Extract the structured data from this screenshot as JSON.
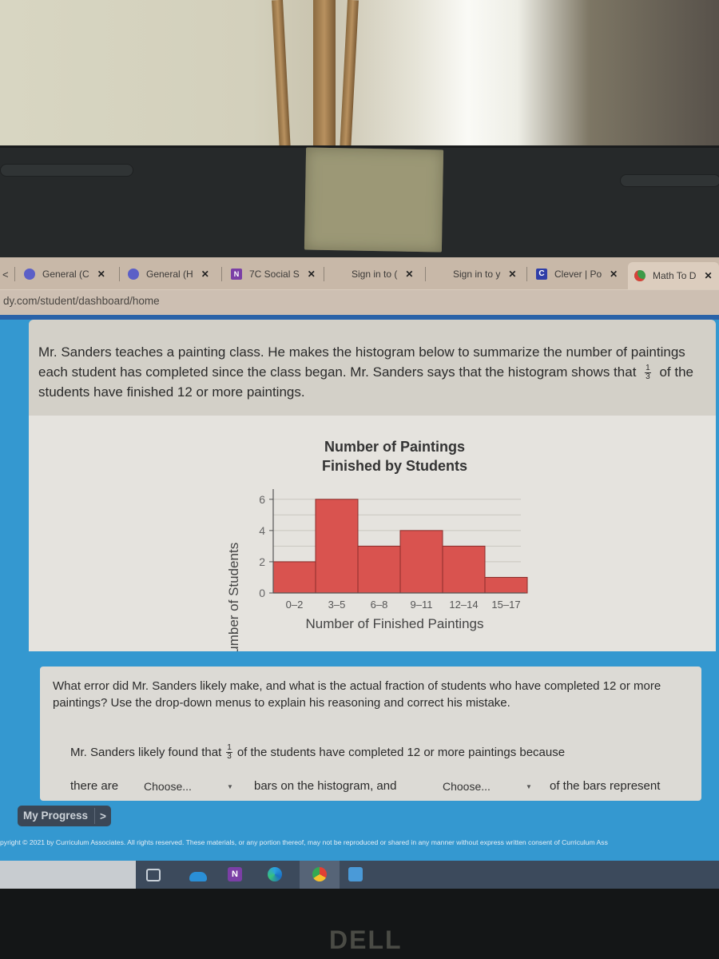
{
  "browser": {
    "tabs": [
      {
        "label": "General (C",
        "icon": "teams-icon"
      },
      {
        "label": "General (H",
        "icon": "teams-icon"
      },
      {
        "label": "7C Social S",
        "icon": "onenote-icon"
      },
      {
        "label": "Sign in to (",
        "icon": "microsoft-icon"
      },
      {
        "label": "Sign in to y",
        "icon": "microsoft-icon"
      },
      {
        "label": "Clever | Po",
        "icon": "clever-icon"
      },
      {
        "label": "Math To D",
        "icon": "math-cube-icon",
        "active": true
      }
    ],
    "close_glyph": "✕",
    "back_glyph": "<",
    "address": "dy.com/student/dashboard/home"
  },
  "problem": {
    "intro_part1": "Mr. Sanders teaches a painting class. He makes the histogram below to summarize the number of paintings each student has completed since the class began. Mr. Sanders says that the histogram shows that",
    "fraction_num": "1",
    "fraction_den": "3",
    "intro_part2": "of the students have finished 12 or more paintings.",
    "question": "What error did Mr. Sanders likely make, and what is the actual fraction of students who have completed 12 or more paintings? Use the drop-down menus to explain his reasoning and correct his mistake.",
    "sentence1_part1": "Mr. Sanders likely found that",
    "sentence1_part2": "of the students have completed 12 or more paintings because",
    "sentence2_a": "there are",
    "sentence2_b": "bars on the histogram, and",
    "sentence2_c": "of the bars represent",
    "dropdown1": "Choose...",
    "dropdown2": "Choose...",
    "caret": "▼"
  },
  "chart_data": {
    "type": "bar",
    "title": "Number of Paintings Finished by Students",
    "title_line1": "Number of Paintings",
    "title_line2": "Finished by Students",
    "xlabel": "Number of Finished Paintings",
    "ylabel": "Number of Students",
    "categories": [
      "0–2",
      "3–5",
      "6–8",
      "9–11",
      "12–14",
      "15–17"
    ],
    "values": [
      2,
      6,
      3,
      4,
      3,
      1
    ],
    "ylim": [
      0,
      6.5
    ],
    "yticks": [
      0,
      2,
      4,
      6
    ],
    "grid": true,
    "bar_color": "#d9534f",
    "histogram": true
  },
  "footer": {
    "my_progress": "My Progress",
    "my_progress_arrow": ">",
    "copyright": "pyright © 2021 by Curriculum Associates. All rights reserved. These materials, or any portion thereof, may not be reproduced or shared in any manner without express written consent of Curriculum Ass"
  },
  "taskbar": {
    "icons": [
      "task-view-icon",
      "onedrive-icon",
      "onenote-icon",
      "edge-icon",
      "chrome-icon",
      "zoom-icon"
    ]
  },
  "device": {
    "brand": "DELL"
  },
  "colors": {
    "page_blue": "#3498d0",
    "bar_red": "#d9534f",
    "progress_bg": "#3b4756"
  }
}
